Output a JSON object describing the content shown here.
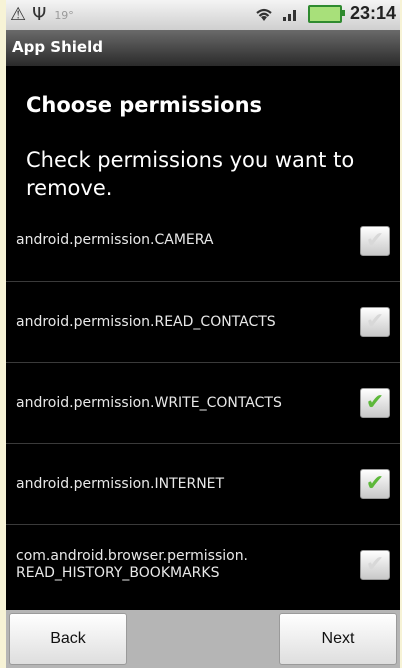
{
  "status_bar": {
    "temperature": "19°",
    "time": "23:14",
    "colors": {
      "battery": "#a8e07a"
    }
  },
  "app": {
    "title": "App Shield"
  },
  "screen": {
    "heading": "Choose permissions",
    "subheading": "Check permissions you want to remove."
  },
  "permissions": [
    {
      "label": "android.permission.CAMERA",
      "checked": false
    },
    {
      "label": "android.permission.READ_CONTACTS",
      "checked": false
    },
    {
      "label": "android.permission.WRITE_CONTACTS",
      "checked": true
    },
    {
      "label": "android.permission.INTERNET",
      "checked": true
    },
    {
      "label": "com.android.browser.permission.\nREAD_HISTORY_BOOKMARKS",
      "checked": false
    }
  ],
  "buttons": {
    "back": "Back",
    "next": "Next"
  },
  "colors": {
    "check_on": "#5db83a",
    "check_off": "#d8d8d8"
  }
}
